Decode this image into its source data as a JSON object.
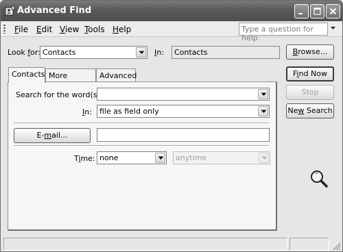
{
  "window": {
    "title": "Advanced Find"
  },
  "menu": {
    "items": [
      {
        "pre": "",
        "key": "F",
        "post": "ile"
      },
      {
        "pre": "",
        "key": "E",
        "post": "dit"
      },
      {
        "pre": "",
        "key": "V",
        "post": "iew"
      },
      {
        "pre": "",
        "key": "T",
        "post": "ools"
      },
      {
        "pre": "",
        "key": "H",
        "post": "elp"
      }
    ],
    "help_placeholder": "Type a question for help"
  },
  "look_for": {
    "label_pre": "Look ",
    "label_key": "f",
    "label_post": "or:",
    "value": "Contacts",
    "in_label_pre": "",
    "in_label_key": "I",
    "in_label_post": "n:",
    "in_value": "Contacts",
    "browse_pre": "",
    "browse_key": "B",
    "browse_post": "rowse..."
  },
  "tabs": [
    {
      "label": "Contacts",
      "active": true
    },
    {
      "label": "More Choices",
      "active": false
    },
    {
      "label": "Advanced",
      "active": false
    }
  ],
  "contacts_tab": {
    "search_words_label_pre": "Search for the word(s):",
    "search_words_value": "",
    "in_label_pre": "",
    "in_label_key": "I",
    "in_label_post": "n:",
    "in_value": "file as field only",
    "email_button_pre": "E-",
    "email_button_key": "m",
    "email_button_post": "ail...",
    "email_value": "",
    "time_label_pre": "T",
    "time_label_key": "i",
    "time_label_post": "me:",
    "time_value": "none",
    "time_range_value": "anytime"
  },
  "actions": {
    "find_now_pre": "F",
    "find_now_key": "i",
    "find_now_post": "nd Now",
    "stop": "Stop",
    "new_search_pre": "Ne",
    "new_search_key": "w",
    "new_search_post": " Search"
  },
  "icons": {
    "app": "address-book-icon",
    "search": "magnifier-icon"
  },
  "colors": {
    "titlebar": "#5a5a5a",
    "window": "#e6e6e6",
    "panel": "#f6f6f6"
  }
}
